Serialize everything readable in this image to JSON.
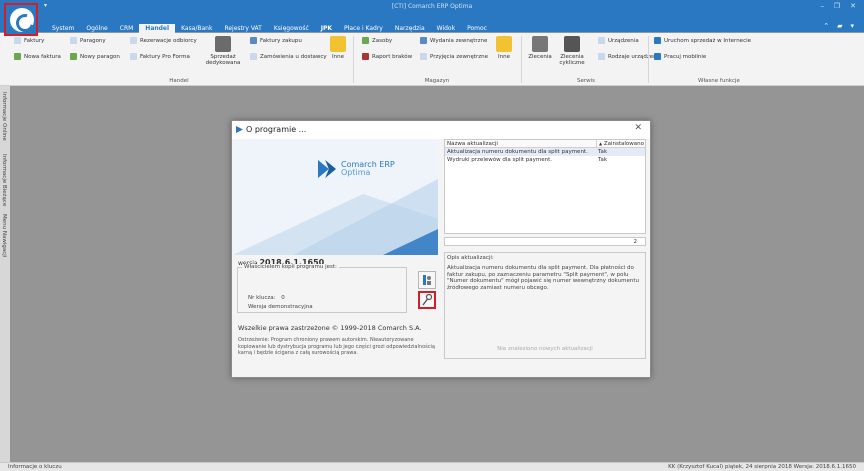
{
  "window": {
    "title": "[CTI] Comarch ERP Optima"
  },
  "menu": {
    "tabs": [
      {
        "label": "System"
      },
      {
        "label": "Ogólne"
      },
      {
        "label": "CRM"
      },
      {
        "label": "Handel"
      },
      {
        "label": "Kasa/Bank"
      },
      {
        "label": "Rejestry VAT"
      },
      {
        "label": "Księgowość"
      },
      {
        "label": "JPK"
      },
      {
        "label": "Płace i Kadry"
      },
      {
        "label": "Narzędzia"
      },
      {
        "label": "Widok"
      },
      {
        "label": "Pomoc"
      }
    ]
  },
  "ribbon": {
    "handel": {
      "faktury": "Faktury",
      "nowa_faktura": "Nowa faktura",
      "paragony": "Paragony",
      "nowy_paragon": "Nowy paragon",
      "rezerwacje": "Rezerwacje odbiorcy",
      "faktury_pro_forma": "Faktury Pro Forma",
      "sprzedaz_dedykowana": "Sprzedaż dedykowana",
      "faktury_zakupu": "Faktury zakupu",
      "zamowienia": "Zamówienia u dostawcy",
      "inne": "Inne",
      "group": "Handel"
    },
    "magazyn": {
      "zasoby": "Zasoby",
      "raport_brakow": "Raport braków",
      "wydania": "Wydania zewnętrzne",
      "przyjecia": "Przyjęcia zewnętrzne",
      "inne": "Inne",
      "group": "Magazyn"
    },
    "serwis": {
      "zlecenia": "Zlecenia",
      "zlecenia_cykliczne": "Zlecenia cykliczne",
      "urzadzenia": "Urządzenia",
      "rodzaje_urzadzen": "Rodzaje urządzeń",
      "group": "Serwis"
    },
    "wlasne": {
      "sprzedaz_internet": "Uruchom sprzedaż w Internecie",
      "pracuj_mobilnie": "Pracuj mobilnie",
      "group": "Własne funkcje"
    }
  },
  "side_tabs": [
    "Informacje Online",
    "Informacje Bieżące",
    "Menu Nawigacji"
  ],
  "status": {
    "left": "Informacje o kluczu",
    "right": "KK (Krzysztof Kucal) piątek, 24 sierpnia 2018 Wersja: 2018.6.1.1650"
  },
  "dialog": {
    "title": "O programie ...",
    "brand_line1": "Comarch ERP",
    "brand_line2": "Optima",
    "version_label": "wersja",
    "version_value": "2018.6.1.1650",
    "license_legend": "Właścicielem kopii programu jest:",
    "key_label": "Nr klucza:",
    "key_value": "0",
    "demo_label": "Wersja demonstracyjna",
    "copyright": "Wszelkie prawa zastrzeżone © 1999-2018 Comarch S.A.",
    "legal": "Ostrzeżenie: Program chroniony prawem autorskim. Nieautoryzowane kopiowanie lub dystrybucja programu lub jego części grozi odpowiedzialnością karną i będzie ścigana z całą surowością prawa.",
    "updates": {
      "col_name": "Nazwa aktualizacji",
      "col_installed": "Zainstalowano",
      "rows": [
        {
          "name": "Aktualizacja numeru dokumentu dla split payment.",
          "installed": "Tak"
        },
        {
          "name": "Wydruki przelewów dla split payment.",
          "installed": "Tak"
        }
      ],
      "count": "2"
    },
    "description_label": "Opis aktualizacji:",
    "description_text": "Aktualizacja numeru dokumentu dla split payment. Dla płatności do faktur zakupu, po zaznaczeniu parametru \"Split payment\", w polu \"Numer dokumentu\" mógł pojawić się numer wewnętrzny dokumentu źródłowego zamiast numeru obcego.",
    "no_updates": "Nie znaleziono nowych aktualizacji"
  },
  "colors": {
    "brand_blue": "#2b78c2",
    "highlight_red": "#d51d25"
  }
}
